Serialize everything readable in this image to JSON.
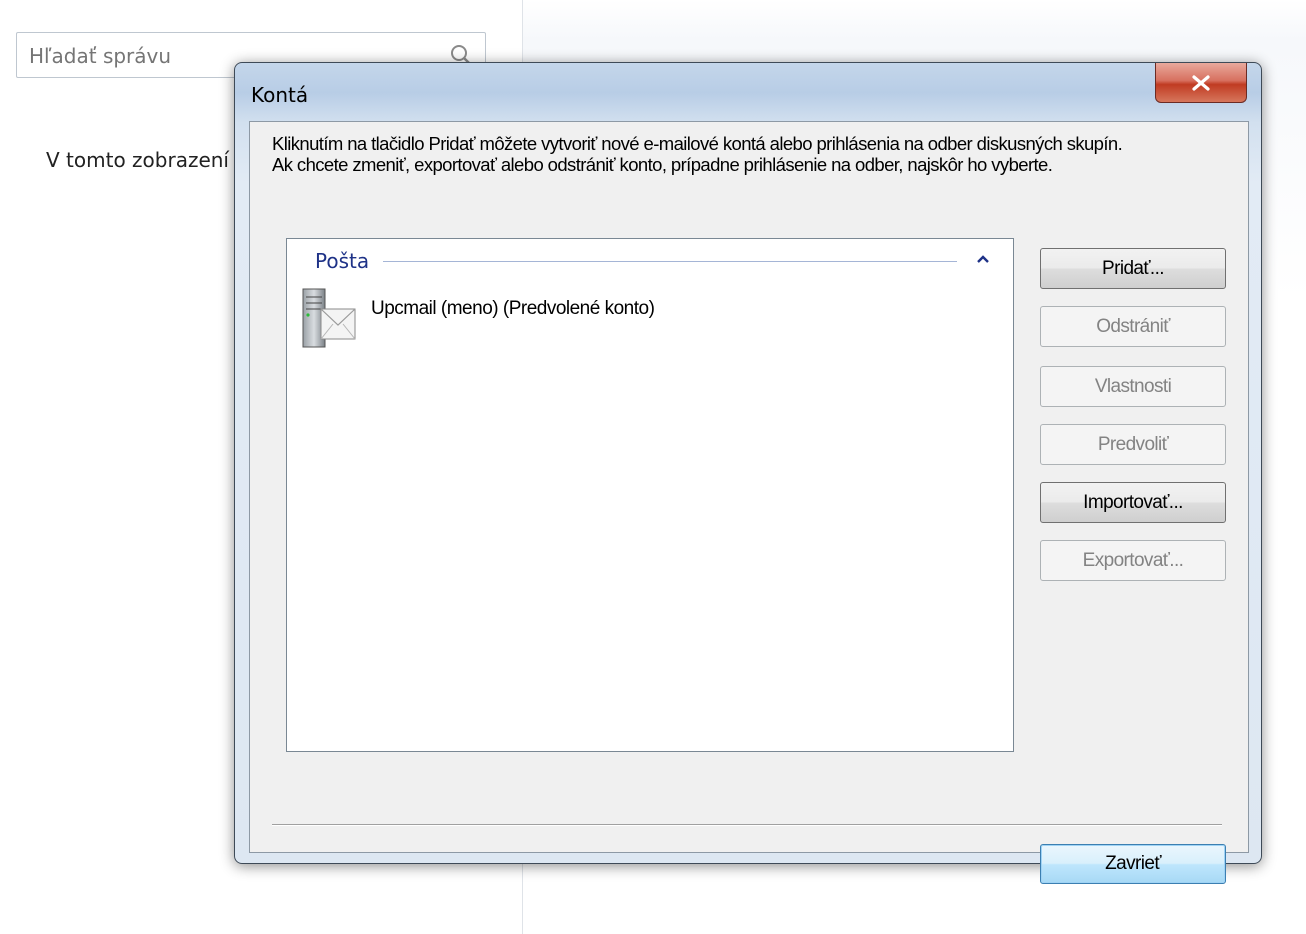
{
  "background": {
    "search": {
      "placeholder": "Hľadať správu"
    },
    "message_text": "V tomto zobrazení"
  },
  "dialog": {
    "title": "Kontá",
    "close_label": "X",
    "info_line1": "Kliknutím na tlačidlo Pridať môžete vytvoriť nové e-mailové kontá alebo prihlásenia na odber diskusných skupín.",
    "info_line2": "Ak chcete zmeniť, exportovať alebo odstrániť konto, prípadne prihlásenie na odber, najskôr ho vyberte.",
    "list": {
      "group": "Pošta",
      "accounts": [
        {
          "label": "Upcmail (meno) (Predvolené konto)"
        }
      ]
    },
    "buttons": {
      "add": "Pridať...",
      "remove": "Odstrániť",
      "properties": "Vlastnosti",
      "set_default": "Predvoliť",
      "import": "Importovať...",
      "export": "Exportovať...",
      "close": "Zavrieť"
    }
  },
  "colors": {
    "group_header": "#1e3287",
    "close_button": "#c03b22",
    "disabled_text": "#838383"
  }
}
